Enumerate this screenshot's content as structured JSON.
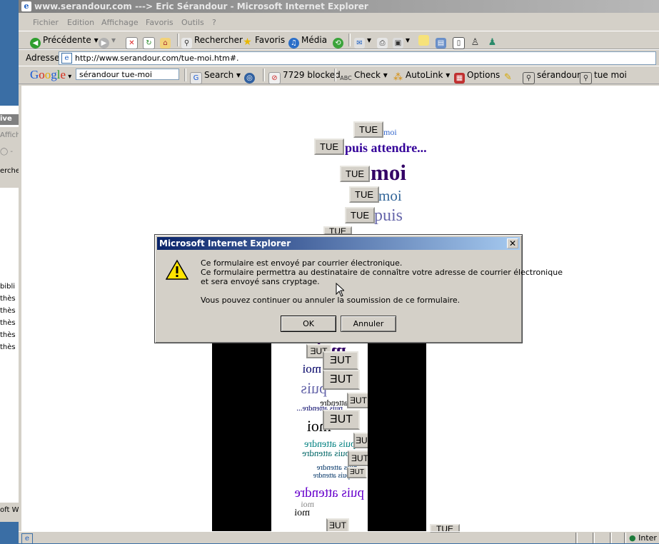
{
  "window": {
    "title": "www.serandour.com ---> Eric Sérandour - Microsoft Internet Explorer"
  },
  "menu": [
    "Fichier",
    "Edition",
    "Affichage",
    "Favoris",
    "Outils",
    "?"
  ],
  "toolbar": {
    "back": "Précédente",
    "search": "Rechercher",
    "favorites": "Favoris",
    "media": "Média"
  },
  "address": {
    "label": "Adresse",
    "url": "http://www.serandour.com/tue-moi.htm#."
  },
  "google": {
    "logo": "Google",
    "query": "sérandour tue-moi",
    "search": "Search",
    "blocked": "7729 blocked",
    "check": "Check",
    "autolink": "AutoLink",
    "options": "Options",
    "term1": "sérandour",
    "term2": "tue moi"
  },
  "background_window": {
    "labels": [
      "ive",
      "Affich",
      "erche",
      "bibli",
      "thès",
      "thès",
      "thès",
      "thès",
      "thès",
      "oft W"
    ]
  },
  "page": {
    "tue_label": "TUE",
    "rows": [
      {
        "word": "moi",
        "color": "#3366cc"
      },
      {
        "word": "puis attendre...",
        "color": "#330099"
      },
      {
        "word": "moi",
        "color": "#330066"
      },
      {
        "word": "moi",
        "color": "#336699"
      },
      {
        "word": "puis",
        "color": "#6666aa"
      },
      {
        "word": "puis attendre",
        "color": "#000000"
      }
    ],
    "mirror_words": [
      "moi",
      "moi",
      "puis",
      "puis attendre",
      "puis attendre...",
      "moi",
      "puis attendre",
      "puis attendre",
      "puis attendre",
      "puis attendre",
      "puis attendre",
      "moi",
      "moi"
    ],
    "bottom_word": "puis attendre"
  },
  "dialog": {
    "title": "Microsoft Internet Explorer",
    "line1": "Ce formulaire est envoyé par courrier électronique.",
    "line2": "Ce formulaire permettra au destinataire de connaître votre adresse de courrier électronique",
    "line3": "et sera envoyé sans cryptage.",
    "line4": "Vous pouvez continuer ou annuler la soumission de ce formulaire.",
    "ok": "OK",
    "cancel": "Annuler"
  },
  "status": {
    "zone": "Inter"
  },
  "colors": {
    "titlebar_active": "#0a246a",
    "window_bg": "#d4d0c8",
    "desktop": "#3a6ea5"
  }
}
